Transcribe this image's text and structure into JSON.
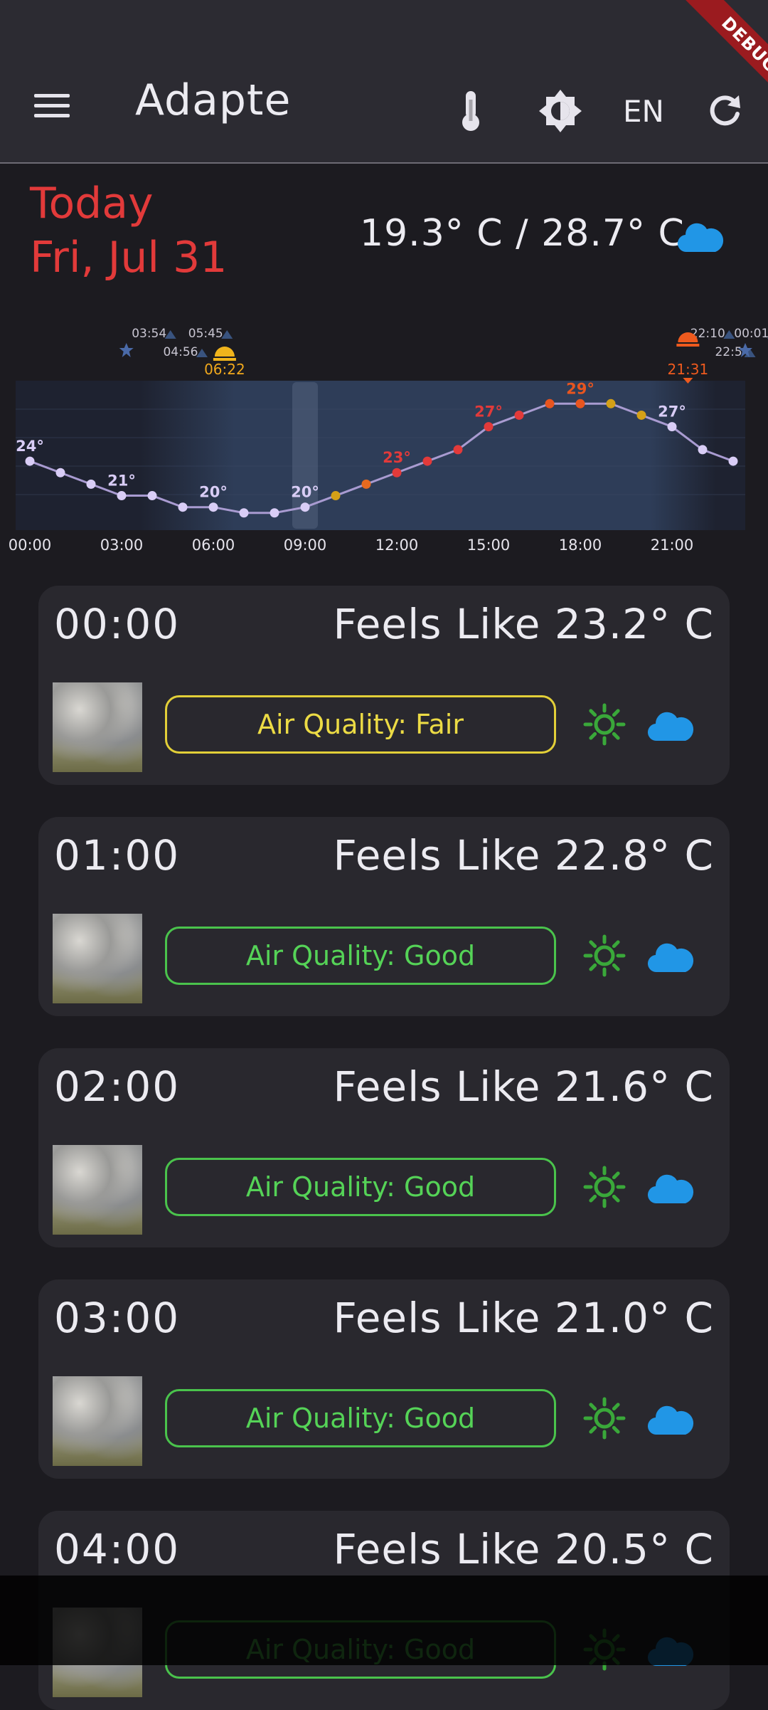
{
  "app_bar": {
    "title": "Adapte",
    "lang": "EN",
    "debug_banner": "DEBUG",
    "icons": [
      "menu-icon",
      "thermometer-icon",
      "brightness-icon",
      "refresh-icon"
    ]
  },
  "today": {
    "label": "Today",
    "date": "Fri, Jul 31",
    "temp_range": "19.3° C / 28.7° C",
    "condition_icon": "cloud-icon"
  },
  "chart_data": {
    "type": "line",
    "x": [
      "00:00",
      "01:00",
      "02:00",
      "03:00",
      "04:00",
      "05:00",
      "06:00",
      "07:00",
      "08:00",
      "09:00",
      "10:00",
      "11:00",
      "12:00",
      "13:00",
      "14:00",
      "15:00",
      "16:00",
      "17:00",
      "18:00",
      "19:00",
      "20:00",
      "21:00",
      "22:00",
      "23:00"
    ],
    "values": [
      24,
      23,
      22,
      21,
      21,
      20,
      20,
      19.5,
      19.5,
      20,
      21,
      22,
      23,
      24,
      25,
      27,
      28,
      29,
      29,
      29,
      28,
      27,
      25,
      24
    ],
    "point_colors": [
      "#d9cdf6",
      "#d9cdf6",
      "#d9cdf6",
      "#d9cdf6",
      "#d9cdf6",
      "#d9cdf6",
      "#d9cdf6",
      "#d9cdf6",
      "#d9cdf6",
      "#d9cdf6",
      "#d4a017",
      "#e66a1f",
      "#e23a3a",
      "#e23a3a",
      "#e23a3a",
      "#e23a3a",
      "#e23a3a",
      "#e8551f",
      "#e8551f",
      "#d4a017",
      "#d4a017",
      "#d9cdf6",
      "#d9cdf6",
      "#d9cdf6"
    ],
    "point_labels": [
      {
        "index": 0,
        "text": "24°",
        "color": "#d9cdf6"
      },
      {
        "index": 3,
        "text": "21°",
        "color": "#d9cdf6"
      },
      {
        "index": 6,
        "text": "20°",
        "color": "#d9cdf6"
      },
      {
        "index": 9,
        "text": "20°",
        "color": "#d9cdf6"
      },
      {
        "index": 12,
        "text": "23°",
        "color": "#e23a3a"
      },
      {
        "index": 15,
        "text": "27°",
        "color": "#e23a3a"
      },
      {
        "index": 18,
        "text": "29°",
        "color": "#e8551f"
      },
      {
        "index": 21,
        "text": "27°",
        "color": "#d9cdf6"
      }
    ],
    "x_tick_labels": [
      "00:00",
      "03:00",
      "06:00",
      "09:00",
      "12:00",
      "15:00",
      "18:00",
      "21:00"
    ],
    "ylim": [
      18,
      31
    ],
    "current_hour": 9,
    "sun_events": [
      {
        "time": "03:54",
        "hour": 3.9,
        "color": "#c9c6d2",
        "row": 0
      },
      {
        "time": "04:56",
        "hour": 4.93,
        "color": "#c9c6d2",
        "row": 1
      },
      {
        "time": "05:45",
        "hour": 5.75,
        "color": "#c9c6d2",
        "row": 0
      },
      {
        "time": "06:22",
        "hour": 6.37,
        "color": "#f0a81c",
        "row": 2
      },
      {
        "time": "21:31",
        "hour": 21.52,
        "color": "#ee5a1e",
        "row": 2
      },
      {
        "time": "22:10",
        "hour": 22.17,
        "color": "#c9c6d2",
        "row": 0
      },
      {
        "time": "22:5",
        "hour": 22.85,
        "color": "#c9c6d2",
        "row": 1
      },
      {
        "time": "00:01",
        "hour": 23.6,
        "color": "#c9c6d2",
        "row": 0
      }
    ]
  },
  "hours": [
    {
      "time": "00:00",
      "feels": "Feels Like 23.2° C",
      "air_quality": "Air Quality: Fair",
      "aq_level": "fair"
    },
    {
      "time": "01:00",
      "feels": "Feels Like 22.8° C",
      "air_quality": "Air Quality: Good",
      "aq_level": "good"
    },
    {
      "time": "02:00",
      "feels": "Feels Like 21.6° C",
      "air_quality": "Air Quality: Good",
      "aq_level": "good"
    },
    {
      "time": "03:00",
      "feels": "Feels Like 21.0° C",
      "air_quality": "Air Quality: Good",
      "aq_level": "good"
    },
    {
      "time": "04:00",
      "feels": "Feels Like 20.5° C",
      "air_quality": "Air Quality: Good",
      "aq_level": "good"
    }
  ],
  "colors": {
    "accent_red": "#e23a3a",
    "aq_good": "#4ac34c",
    "aq_fair": "#e2cf38",
    "cloud": "#2196e6",
    "sun_icon": "#3aa83a"
  }
}
